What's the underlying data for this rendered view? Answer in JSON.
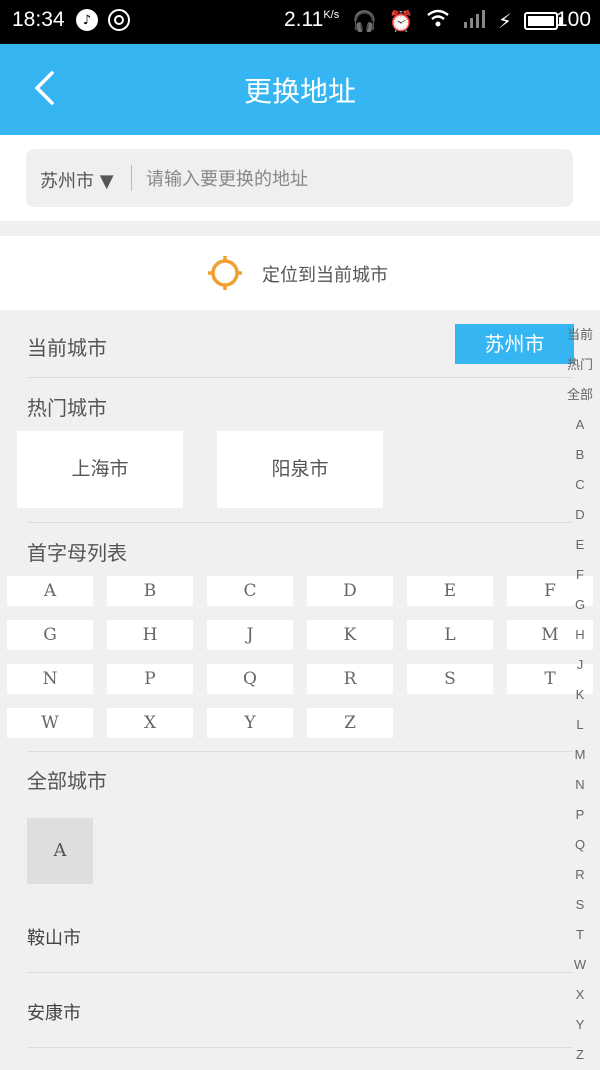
{
  "status": {
    "time": "18:34",
    "speed": "2.11",
    "speed_unit": "K/s",
    "battery": "100"
  },
  "header": {
    "title": "更换地址"
  },
  "search": {
    "city": "苏州市 ▼",
    "placeholder": "请输入要更换的地址"
  },
  "locate": {
    "label": "定位到当前城市"
  },
  "current": {
    "title": "当前城市",
    "city": "苏州市"
  },
  "hot": {
    "title": "热门城市",
    "cities": [
      "上海市",
      "阳泉市"
    ]
  },
  "letters": {
    "title": "首字母列表",
    "rows": [
      [
        "A",
        "B",
        "C",
        "D",
        "E",
        "F"
      ],
      [
        "G",
        "H",
        "J",
        "K",
        "L",
        "M"
      ],
      [
        "N",
        "P",
        "Q",
        "R",
        "S",
        "T"
      ],
      [
        "W",
        "X",
        "Y",
        "Z"
      ]
    ]
  },
  "all": {
    "title": "全部城市",
    "first_letter": "A",
    "cities": [
      "鞍山市",
      "安康市"
    ]
  },
  "index": [
    "当前",
    "热门",
    "全部",
    "A",
    "B",
    "C",
    "D",
    "E",
    "F",
    "G",
    "H",
    "J",
    "K",
    "L",
    "M",
    "N",
    "P",
    "Q",
    "R",
    "S",
    "T",
    "W",
    "X",
    "Y",
    "Z"
  ],
  "colors": {
    "accent": "#35b6f2",
    "locate_icon": "#f0a030"
  }
}
